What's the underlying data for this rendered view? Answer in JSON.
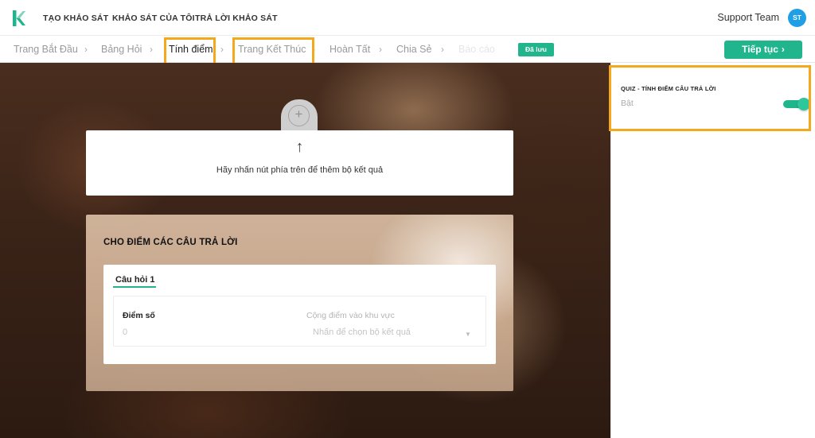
{
  "nav": {
    "items": [
      "TẠO KHẢO SÁT",
      "KHẢO SÁT CỦA TÔI",
      "TRẢ LỜI KHẢO SÁT"
    ],
    "user_name": "Support Team",
    "avatar_initials": "ST"
  },
  "breadcrumb": {
    "steps": [
      "Trang Bắt Đầu",
      "Bảng Hỏi",
      "Tính điểm",
      "Trang Kết Thúc",
      "Hoàn Tất",
      "Chia Sẻ",
      "Báo cáo"
    ],
    "active_index": 2,
    "separator": "›",
    "saved_label": "Đã lưu",
    "continue_label": "Tiếp tục",
    "continue_chevron": "›"
  },
  "canvas": {
    "add_symbol": "+",
    "hint_arrow": "↑",
    "hint_text": "Hãy nhấn nút phía trên để thêm bộ kết quả",
    "panel_title": "CHO ĐIỂM CÁC CÂU TRẢ LỜI",
    "question": {
      "tab_label": "Câu hỏi 1",
      "score_label": "Điểm số",
      "score_value": "0",
      "area_label": "Cộng điểm vào khu vực",
      "area_placeholder": "Nhấn để chọn bộ kết quả",
      "caret": "▼"
    }
  },
  "settings": {
    "title": "QUIZ - TÍNH ĐIỂM CÂU TRẢ LỜI",
    "state_label": "Bật",
    "enabled": true
  },
  "colors": {
    "accent": "#20b58c",
    "highlight": "#f4a81b",
    "avatar": "#1fa0e6"
  }
}
